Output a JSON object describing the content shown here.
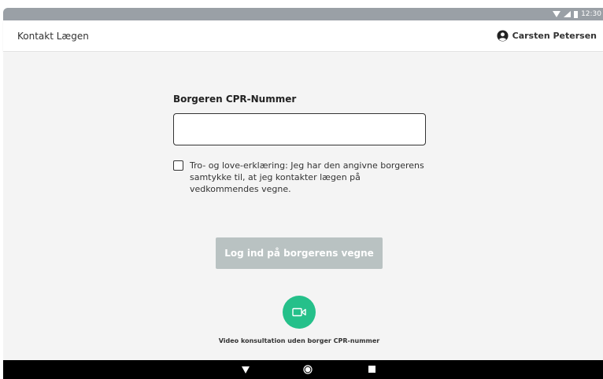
{
  "status_bar": {
    "time": "12:30",
    "icons": [
      "wifi-icon",
      "signal-icon",
      "battery-icon"
    ]
  },
  "header": {
    "title": "Kontakt Lægen",
    "user_name": "Carsten Petersen",
    "user_icon": "user-icon"
  },
  "form": {
    "cpr_label": "Borgeren CPR-Nummer",
    "cpr_value": "",
    "cpr_placeholder": "",
    "consent_text": "Tro- og love-erklæring: Jeg har den angivne borgerens samtykke til, at jeg kontakter lægen på vedkommendes vegne.",
    "consent_checked": false,
    "login_button_label": "Log ind på borgerens vegne"
  },
  "video": {
    "icon": "video-camera-icon",
    "caption": "Video konsultation uden borger CPR-nummer"
  },
  "colors": {
    "status_bar": "#9aa0a6",
    "video_button": "#25c08a",
    "login_button_disabled": "#b9c2c2",
    "main_background": "#f4f4f4"
  }
}
